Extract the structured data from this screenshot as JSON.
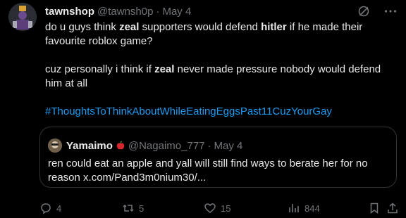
{
  "tweet": {
    "name": "tawnshop",
    "handle": "@tawnsh0p",
    "date": "May 4",
    "line1_a": "do u guys think ",
    "line1_b": "zeal",
    "line1_c": " supporters would defend ",
    "line1_d": "hitler",
    "line1_e": " if he made their favourite roblox game?",
    "line2_a": "cuz personally i think if ",
    "line2_b": "zeal",
    "line2_c": " never made pressure nobody would defend him at all",
    "hashtag": "#ThoughtsToThinkAboutWhileEatingEggsPast11CuzYourGay"
  },
  "quote": {
    "name": "Yamaimo",
    "handle": "@Nagaimo_777",
    "date": "May 4",
    "text": "ren could eat an apple and yall will still find ways to berate her for no reason x.com/Pand3m0nium30/..."
  },
  "actions": {
    "replies": "4",
    "reposts": "5",
    "likes": "15",
    "views": "844"
  },
  "colors": {
    "link": "#1d9bf0",
    "muted": "#71767b",
    "text": "#e7e9ea",
    "bg": "#000000"
  }
}
